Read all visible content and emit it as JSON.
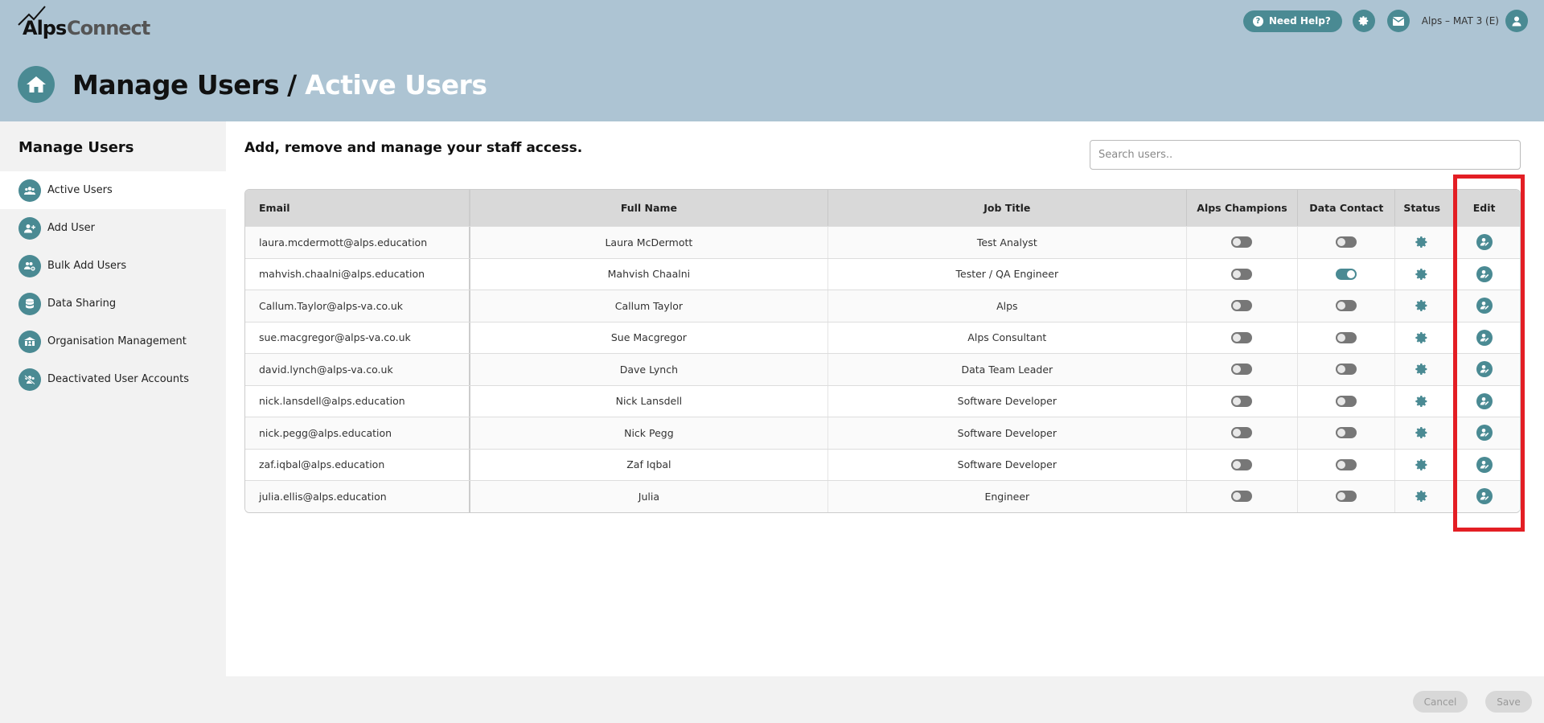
{
  "app": {
    "brand_part1": "Alps",
    "brand_part2": "Connect"
  },
  "topbar": {
    "help_label": "Need Help?",
    "user_label": "Alps – MAT 3 (E)"
  },
  "page": {
    "title": "Manage Users",
    "separator": "/",
    "subtitle": "Active Users"
  },
  "sidebar": {
    "heading": "Manage Users",
    "items": [
      {
        "label": "Active Users",
        "icon": "users-icon",
        "active": true
      },
      {
        "label": "Add User",
        "icon": "add-user-icon"
      },
      {
        "label": "Bulk Add Users",
        "icon": "bulk-add-users-icon"
      },
      {
        "label": "Data Sharing",
        "icon": "database-icon"
      },
      {
        "label": "Organisation Management",
        "icon": "organisation-icon"
      },
      {
        "label": "Deactivated User Accounts",
        "icon": "deactivated-users-icon"
      }
    ]
  },
  "main": {
    "heading": "Add, remove and manage your staff access.",
    "search_placeholder": "Search users.."
  },
  "table": {
    "columns": [
      "Email",
      "Full Name",
      "Job Title",
      "Alps Champions",
      "Data Contact",
      "Status",
      "Edit"
    ],
    "rows": [
      {
        "email": "laura.mcdermott@alps.education",
        "name": "Laura McDermott",
        "job": "Test Analyst",
        "champion": false,
        "data_contact": false
      },
      {
        "email": "mahvish.chaalni@alps.education",
        "name": "Mahvish Chaalni",
        "job": "Tester / QA Engineer",
        "champion": false,
        "data_contact": true
      },
      {
        "email": "Callum.Taylor@alps-va.co.uk",
        "name": "Callum Taylor",
        "job": "Alps",
        "champion": false,
        "data_contact": false
      },
      {
        "email": "sue.macgregor@alps-va.co.uk",
        "name": "Sue Macgregor",
        "job": "Alps Consultant",
        "champion": false,
        "data_contact": false
      },
      {
        "email": "david.lynch@alps-va.co.uk",
        "name": "Dave Lynch",
        "job": "Data Team Leader",
        "champion": false,
        "data_contact": false
      },
      {
        "email": "nick.lansdell@alps.education",
        "name": "Nick Lansdell",
        "job": "Software Developer",
        "champion": false,
        "data_contact": false
      },
      {
        "email": "nick.pegg@alps.education",
        "name": "Nick Pegg",
        "job": "Software Developer",
        "champion": false,
        "data_contact": false
      },
      {
        "email": "zaf.iqbal@alps.education",
        "name": "Zaf Iqbal",
        "job": "Software Developer",
        "champion": false,
        "data_contact": false
      },
      {
        "email": "julia.ellis@alps.education",
        "name": "Julia",
        "job": "Engineer",
        "champion": false,
        "data_contact": false
      }
    ]
  },
  "footer": {
    "cancel_label": "Cancel",
    "save_label": "Save"
  },
  "colors": {
    "accent": "#4a8a93",
    "header_bg": "#adc4d3",
    "highlight": "#e31e24"
  }
}
